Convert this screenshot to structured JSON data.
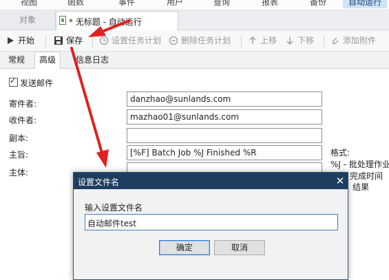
{
  "menu": {
    "items": [
      "视图",
      "函数",
      "事件",
      "用户",
      "查询",
      "报表",
      "备份",
      "自动运行"
    ],
    "active_index": 7
  },
  "tabs": {
    "objects_label": "对象",
    "document_title": "* 无标题 - 自动运行"
  },
  "toolbar": {
    "start_label": "开始",
    "save_label": "保存",
    "set_schedule_label": "设置任务计划",
    "delete_schedule_label": "删除任务计划",
    "move_up_label": "上移",
    "move_down_label": "下移",
    "add_attachment_label": "添加附件"
  },
  "subtabs": {
    "general": "常规",
    "advanced": "高级",
    "log": "信息日志",
    "active": "advanced"
  },
  "form": {
    "send_email_label": "发送邮件",
    "send_email_checked": true,
    "sender_label": "寄件者:",
    "sender_value": "danzhao@sunlands.com",
    "recipient_label": "收件者:",
    "recipient_value": "mazhao01@sunlands.com",
    "cc_label": "副本:",
    "cc_value": "",
    "subject_label": "主旨:",
    "subject_value": "[%F] Batch Job %J Finished %R",
    "body_label": "主体:"
  },
  "format_hint": {
    "title": "格式:",
    "line1": "%J - 批处理作业",
    "line2": "完成时间",
    "line3": "结果"
  },
  "dialog": {
    "title": "设置文件名",
    "close_glyph": "✕",
    "prompt": "输入设置文件名",
    "input_value": "自动邮件test",
    "ok_label": "确定",
    "cancel_label": "取消"
  },
  "colors": {
    "dialog_titlebar": "#1e3e60",
    "annotation_arrow": "#e02020",
    "active_menu": "#cfe3f7"
  }
}
